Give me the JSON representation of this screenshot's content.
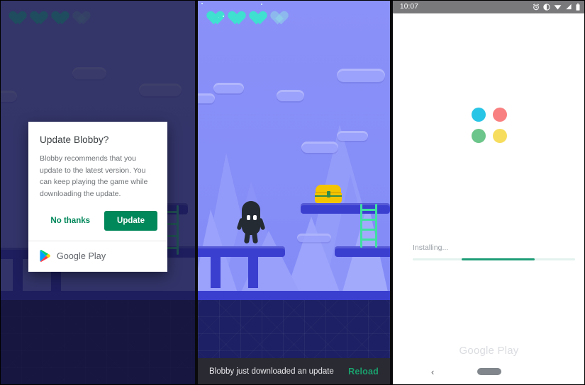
{
  "panels": {
    "dialog_panel": {
      "name": "update-dialog-screen",
      "dialog": {
        "title": "Update Blobby?",
        "body": "Blobby recommends that you update to the latest version. You can keep playing the game while downloading the update.",
        "dismiss_label": "No thanks",
        "confirm_label": "Update",
        "brand": "Google Play",
        "accent_color": "#00875a"
      },
      "hud": {
        "hearts_total": 4,
        "hearts_full": 3
      }
    },
    "game_panel": {
      "name": "game-screen",
      "hud": {
        "hearts_total": 4,
        "hearts_full": 3
      },
      "snackbar": {
        "message": "Blobby just downloaded an update",
        "action_label": "Reload",
        "action_color": "#1aa06d"
      },
      "scene": {
        "sky_color": "#8189f7",
        "platform_color": "#3b3fd0",
        "ground_color": "#1d2064",
        "character": "blob-character",
        "items": [
          "treasure-chest",
          "ladder"
        ]
      }
    },
    "install_panel": {
      "name": "installing-screen",
      "statusbar": {
        "clock": "10:07",
        "icons": [
          "alarm-icon",
          "do-not-disturb-icon",
          "wifi-icon",
          "signal-icon",
          "battery-icon"
        ]
      },
      "progress": {
        "label": "Installing...",
        "track_color": "#e3f2ee",
        "fill_color": "#1f9d76"
      },
      "dots": [
        {
          "name": "dot-blue",
          "color": "#29c5e6"
        },
        {
          "name": "dot-red",
          "color": "#f98080"
        },
        {
          "name": "dot-green",
          "color": "#6cc58a"
        },
        {
          "name": "dot-yellow",
          "color": "#f7dd5e"
        }
      ],
      "brand": "Google Play",
      "navbar": {
        "back_icon": "back-chevron-icon",
        "home_pill": "home-gesture-pill"
      }
    }
  }
}
